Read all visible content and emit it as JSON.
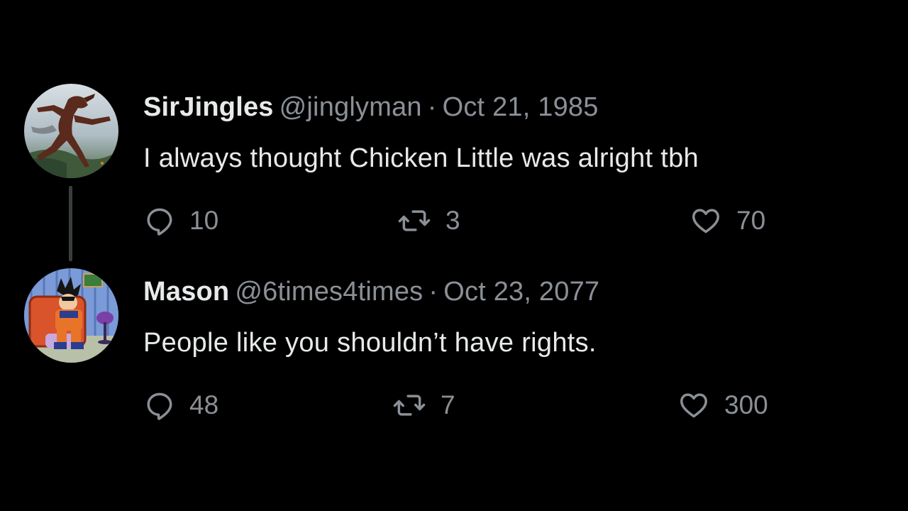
{
  "tweets": [
    {
      "display_name": "SirJingles",
      "handle": "@jinglyman",
      "separator": "·",
      "date": "Oct 21, 1985",
      "text": "I always thought Chicken Little was alright tbh",
      "replies": "10",
      "retweets": "3",
      "likes": "70",
      "avatar_icon": "creature-avatar"
    },
    {
      "display_name": "Mason",
      "handle": "@6times4times",
      "separator": "·",
      "date": "Oct 23, 2077",
      "text": "People like you shouldn’t have rights.",
      "replies": "48",
      "retweets": "7",
      "likes": "300",
      "avatar_icon": "cartoon-character-avatar"
    }
  ],
  "icons": {
    "reply": "reply-icon",
    "retweet": "retweet-icon",
    "like": "heart-icon"
  },
  "colors": {
    "background": "#000000",
    "primary_text": "#e7e9ea",
    "secondary_text": "#8b9096",
    "thread_line": "#3a3d40"
  }
}
